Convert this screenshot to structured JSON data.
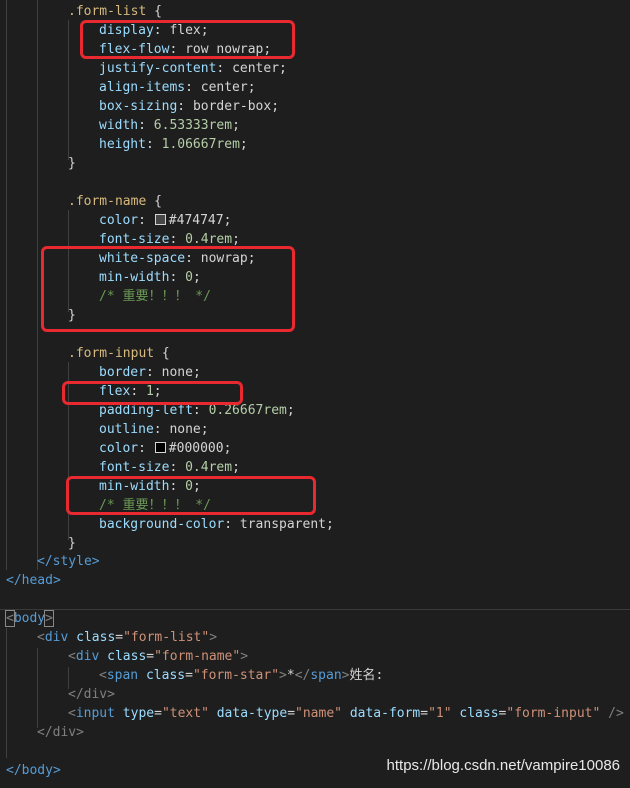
{
  "code": {
    "css": [
      {
        "selector": ".form-list",
        "open": " {"
      },
      {
        "prop": "display",
        "value": "flex"
      },
      {
        "prop": "flex-flow",
        "value": "row nowrap"
      },
      {
        "prop": "justify-content",
        "value": "center"
      },
      {
        "prop": "align-items",
        "value": "center"
      },
      {
        "prop": "box-sizing",
        "value": "border-box"
      },
      {
        "prop": "width",
        "value": "6.53333rem"
      },
      {
        "prop": "height",
        "value": "1.06667rem"
      },
      {
        "close": "}"
      },
      {
        "selector": ".form-name",
        "open": " {"
      },
      {
        "prop": "color",
        "value": "#474747",
        "swatch": "#474747"
      },
      {
        "prop": "font-size",
        "value": "0.4rem"
      },
      {
        "prop": "white-space",
        "value": "nowrap"
      },
      {
        "prop": "min-width",
        "value": "0"
      },
      {
        "comment": "/* 重要！！！ */"
      },
      {
        "close": "}"
      },
      {
        "selector": ".form-input",
        "open": " {"
      },
      {
        "prop": "border",
        "value": "none"
      },
      {
        "prop": "flex",
        "value": "1"
      },
      {
        "prop": "padding-left",
        "value": "0.26667rem"
      },
      {
        "prop": "outline",
        "value": "none"
      },
      {
        "prop": "color",
        "value": "#000000",
        "swatch": "#000000"
      },
      {
        "prop": "font-size",
        "value": "0.4rem"
      },
      {
        "prop": "min-width",
        "value": "0"
      },
      {
        "comment": "/* 重要！！！ */"
      },
      {
        "prop": "background-color",
        "value": "transparent"
      },
      {
        "close": "}"
      }
    ],
    "style_close": "</style>",
    "head_close": "</head>",
    "body_open": "<body>",
    "div_open_tag": "div",
    "div_class_attr": "class",
    "div_class_val": "\"form-list\"",
    "name_div_class_val": "\"form-name\"",
    "span_tag": "span",
    "span_class_val": "\"form-star\"",
    "span_text": "*",
    "after_span_text": "姓名:",
    "div_close": "</div>",
    "input_tag": "input",
    "input_type_attr": "type",
    "input_type_val": "\"text\"",
    "input_dt_attr": "data-type",
    "input_dt_val": "\"name\"",
    "input_df_attr": "data-form",
    "input_df_val": "\"1\"",
    "input_class_attr": "class",
    "input_class_val": "\"form-input\"",
    "input_self_close": "/>",
    "body_close": "</body>"
  },
  "watermark": "https://blog.csdn.net/vampire10086",
  "colors": {
    "background": "#1e1e1e",
    "highlight_box": "#e8292f"
  }
}
